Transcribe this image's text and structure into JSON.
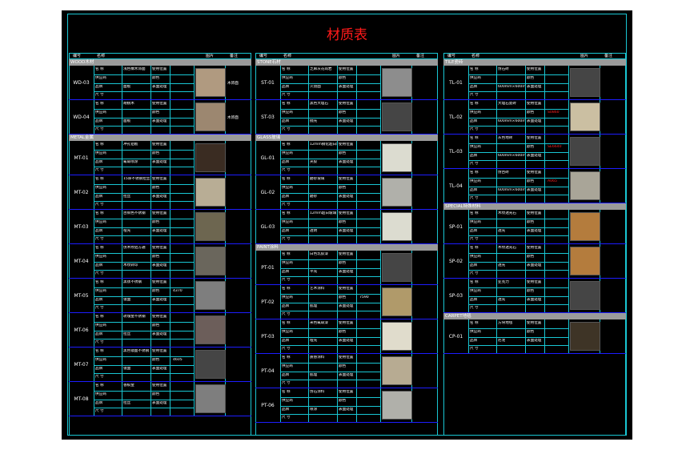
{
  "title": "材质表",
  "headers": {
    "code": "编号",
    "name": "名称",
    "image": "图片",
    "note": "备注"
  },
  "labels": {
    "name": "名 称",
    "supplier": "供应商",
    "size": "尺 寸",
    "brand": "品牌",
    "spec": "规格",
    "color": "颜色",
    "finish": "表面处理",
    "place": "使用位置"
  },
  "columns": [
    {
      "sections": [
        {
          "name": "WOOD木材",
          "rows": [
            {
              "code": "WD-03",
              "note": "木饰面",
              "v1": "浅色橡木饰面",
              "v2": "面板"
            },
            {
              "code": "WD-04",
              "note": "木饰面",
              "v1": "胡桃木",
              "v2": "面板"
            }
          ]
        },
        {
          "name": "METAL金属",
          "rows": [
            {
              "code": "MT-01",
              "v1": "冲孔铝板",
              "v2": "氟碳喷涂"
            },
            {
              "code": "MT-02",
              "v1": "15厚不锈钢拉丝",
              "v2": "拉丝"
            },
            {
              "code": "MT-03",
              "v1": "古铜色不锈钢",
              "v2": "哑光"
            },
            {
              "code": "MT-04",
              "v1": "仿木纹铝方通",
              "v2": "木纹转印"
            },
            {
              "code": "MT-05",
              "v1": "黑钛不锈钢",
              "v2": "镜面",
              "extra": "4370"
            },
            {
              "code": "MT-06",
              "v1": "玫瑰金不锈钢",
              "v2": "拉丝"
            },
            {
              "code": "MT-07",
              "v1": "黑色镜面不锈钢",
              "v2": "镜面",
              "extra": "4605"
            },
            {
              "code": "MT-08",
              "v1": "香槟金",
              "v2": "拉丝"
            }
          ]
        }
      ]
    },
    {
      "sections": [
        {
          "name": "STONE石材",
          "rows": [
            {
              "code": "ST-01",
              "v1": "芝麻灰花岗岩",
              "v2": "火烧面"
            },
            {
              "code": "ST-03",
              "v1": "黑色大理石",
              "v2": "抛光"
            }
          ]
        },
        {
          "name": "GLASS玻璃",
          "rows": [
            {
              "code": "GL-01",
              "v1": "12mm钢化超白玻璃",
              "v2": "夹胶"
            },
            {
              "code": "GL-02",
              "v1": "磨砂玻璃",
              "v2": "磨砂"
            },
            {
              "code": "GL-03",
              "v1": "12mm超白玻璃",
              "v2": "透明"
            }
          ]
        },
        {
          "name": "PAINT涂料",
          "rows": [
            {
              "code": "PT-01",
              "v1": "白色乳胶漆",
              "v2": "平光"
            },
            {
              "code": "PT-02",
              "v1": "艺术涂料",
              "v2": "肌理",
              "extra": "7590"
            },
            {
              "code": "PT-03",
              "v1": "米色氟碳漆",
              "v2": "哑光"
            },
            {
              "code": "PT-04",
              "v1": "质感涂料",
              "v2": "肌理"
            },
            {
              "code": "PT-06",
              "v1": "仿石涂料",
              "v2": "喷涂"
            }
          ]
        }
      ]
    },
    {
      "sections": [
        {
          "name": "TILE瓷砖",
          "rows": [
            {
              "code": "TL-01",
              "v1": "仿石砖",
              "v2": "600mm×600mm"
            },
            {
              "code": "TL-02",
              "v1": "大理石瓷砖",
              "v2": "600mm×600mm",
              "red": "S0860"
            },
            {
              "code": "TL-03",
              "v1": "灰色地砖",
              "v2": "600mm×600mm",
              "red": "SE6640"
            },
            {
              "code": "TL-04",
              "v1": "仿古砖",
              "v2": "600mm×600mm",
              "red": "A065"
            }
          ]
        },
        {
          "name": "SPECIAL特殊材料",
          "rows": [
            {
              "code": "SP-01",
              "v1": "木纹透光石",
              "v2": "透光"
            },
            {
              "code": "SP-02",
              "v1": "木纹透光石",
              "v2": "透光"
            },
            {
              "code": "SP-03",
              "v1": "亚克力",
              "v2": "透光"
            }
          ]
        },
        {
          "name": "CARPET地毯",
          "rows": [
            {
              "code": "CP-01",
              "v1": "方块地毯",
              "v2": "尼龙"
            }
          ]
        }
      ]
    }
  ],
  "swatch_colors": {
    "light_wood": "#b09a80",
    "dark_wood": "#9c8770",
    "mesh": "#3a2c22",
    "cream": "#b8ad95",
    "bronze": "#6d6650",
    "stripe": "#6a665c",
    "grey": "#7e7e7e",
    "plum": "#6c5e5a",
    "dark": "#454545",
    "granite": "#8d8d8d",
    "glass": "#dcdcd0",
    "frost": "#b0b0aa",
    "paint_gold": "#b09a6a",
    "paint_cream": "#e0dccc",
    "sand": "#b7ab92",
    "tile_light": "#cbbfa2",
    "tile_grey": "#a9a598",
    "onyx": "#b47c3d",
    "carpet": "#3e3426"
  }
}
